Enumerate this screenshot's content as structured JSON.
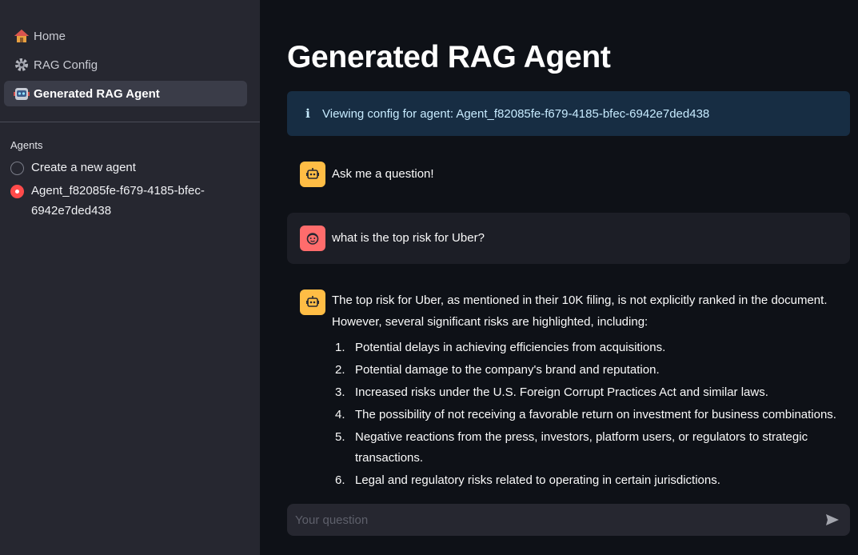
{
  "sidebar": {
    "nav": [
      {
        "label": "Home",
        "icon": "house-icon"
      },
      {
        "label": "RAG Config",
        "icon": "gear-icon"
      },
      {
        "label": "Generated RAG Agent",
        "icon": "robot-icon",
        "active": true
      }
    ],
    "agents_label": "Agents",
    "agents": [
      {
        "label": "Create a new agent",
        "selected": false
      },
      {
        "label": "Agent_f82085fe-f679-4185-bfec-6942e7ded438",
        "selected": true
      }
    ]
  },
  "main": {
    "title": "Generated RAG Agent",
    "info": {
      "icon": "info-icon",
      "text": "Viewing config for agent: Agent_f82085fe-f679-4185-bfec-6942e7ded438"
    },
    "messages": [
      {
        "role": "assistant",
        "text": "Ask me a question!"
      },
      {
        "role": "user",
        "text": "what is the top risk for Uber?"
      }
    ],
    "answer": {
      "intro": "The top risk for Uber, as mentioned in their 10K filing, is not explicitly ranked in the document. However, several significant risks are highlighted, including:",
      "items": [
        {
          "num": "1.",
          "text": "Potential delays in achieving efficiencies from acquisitions."
        },
        {
          "num": "2.",
          "text": "Potential damage to the company's brand and reputation."
        },
        {
          "num": "3.",
          "text": "Increased risks under the U.S. Foreign Corrupt Practices Act and similar laws."
        },
        {
          "num": "4.",
          "text": "The possibility of not receiving a favorable return on investment for business combinations."
        },
        {
          "num": "5.",
          "text": "Negative reactions from the press, investors, platform users, or regulators to strategic transactions."
        },
        {
          "num": "6.",
          "text": "Legal and regulatory risks related to operating in certain jurisdictions."
        }
      ]
    },
    "input": {
      "placeholder": "Your question",
      "value": ""
    }
  },
  "colors": {
    "accent": "#ff4b4b",
    "info_bg": "#172d43",
    "bot_avatar": "#ffbd45",
    "user_avatar": "#ff6c6c"
  }
}
